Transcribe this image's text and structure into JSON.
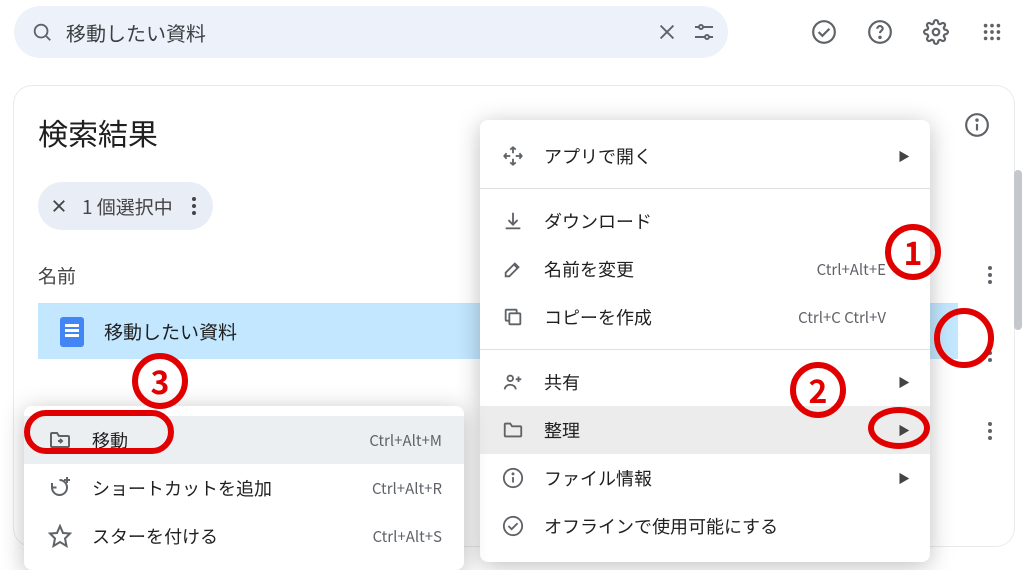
{
  "search": {
    "query": "移動したい資料"
  },
  "page": {
    "title": "検索結果",
    "selection_text": "1 個選択中",
    "column_name": "名前",
    "file_name": "移動したい資料"
  },
  "context_menu": {
    "open_with": "アプリで開く",
    "download": "ダウンロード",
    "rename": "名前を変更",
    "rename_kbd": "Ctrl+Alt+E",
    "make_copy": "コピーを作成",
    "make_copy_kbd": "Ctrl+C Ctrl+V",
    "share": "共有",
    "organize": "整理",
    "file_info": "ファイル情報",
    "offline": "オフラインで使用可能にする"
  },
  "submenu": {
    "move": "移動",
    "move_kbd": "Ctrl+Alt+M",
    "add_shortcut": "ショートカットを追加",
    "add_shortcut_kbd": "Ctrl+Alt+R",
    "star": "スターを付ける",
    "star_kbd": "Ctrl+Alt+S"
  },
  "annotations": {
    "one": "1",
    "two": "2",
    "three": "3"
  }
}
